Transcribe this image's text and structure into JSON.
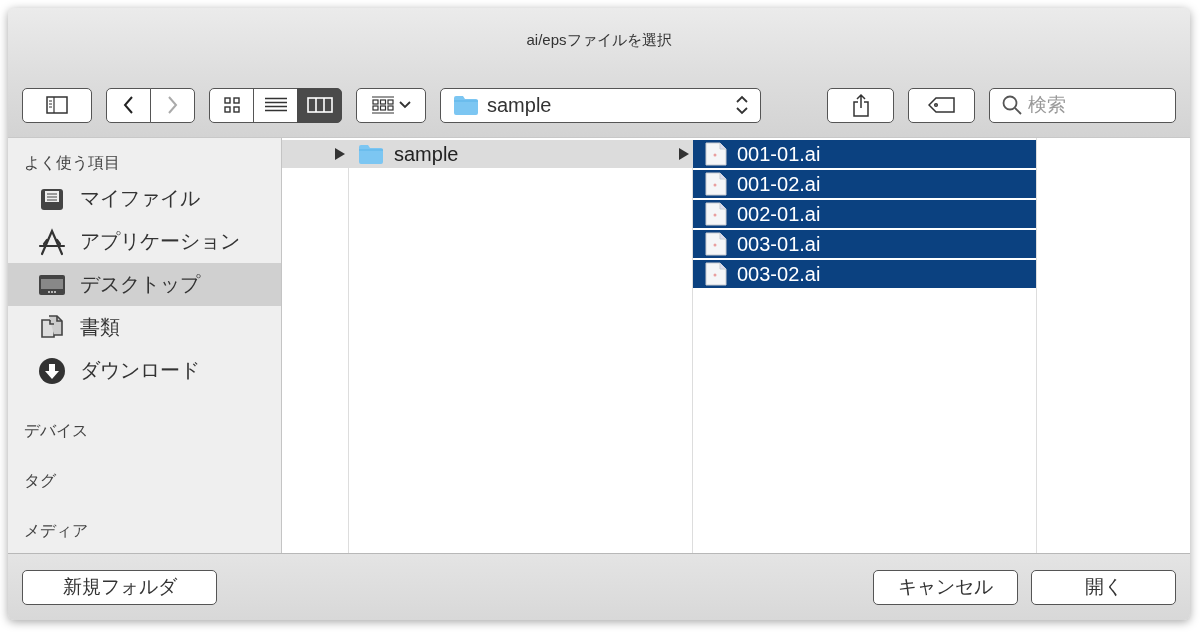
{
  "window": {
    "title": "ai/epsファイルを選択"
  },
  "toolbar": {
    "navigation": [
      {
        "kind": "back",
        "disabled": false
      },
      {
        "kind": "forward",
        "disabled": true
      }
    ],
    "view_modes": [
      {
        "kind": "icons",
        "selected": false
      },
      {
        "kind": "list",
        "selected": false
      },
      {
        "kind": "columns",
        "selected": true
      }
    ],
    "location": "sample",
    "search": {
      "placeholder": "検索"
    }
  },
  "sidebar": {
    "sections": [
      {
        "title": "よく使う項目",
        "items": [
          {
            "label": "マイファイル",
            "kind": "myfiles",
            "selected": false
          },
          {
            "label": "アプリケーション",
            "kind": "applications",
            "selected": false
          },
          {
            "label": "デスクトップ",
            "kind": "desktop",
            "selected": true
          },
          {
            "label": "書類",
            "kind": "documents",
            "selected": false
          },
          {
            "label": "ダウンロード",
            "kind": "downloads",
            "selected": false
          }
        ]
      },
      {
        "title": "デバイス"
      },
      {
        "title": "タグ"
      },
      {
        "title": "メディア"
      }
    ]
  },
  "browser": {
    "columns": [
      {
        "rows": [
          {
            "label": "sample",
            "kind": "folder",
            "selected": true
          }
        ]
      },
      {
        "rows": [
          {
            "label": "001-01.ai",
            "kind": "file",
            "selected": true
          },
          {
            "label": "001-02.ai",
            "kind": "file",
            "selected": true
          },
          {
            "label": "002-01.ai",
            "kind": "file",
            "selected": true
          },
          {
            "label": "003-01.ai",
            "kind": "file",
            "selected": true
          },
          {
            "label": "003-02.ai",
            "kind": "file",
            "selected": true
          }
        ]
      }
    ]
  },
  "buttons": [
    {
      "label": "新規フォルダ",
      "kind": "new_folder"
    },
    {
      "label": "キャンセル",
      "kind": "cancel"
    },
    {
      "label": "開く",
      "kind": "open"
    }
  ]
}
